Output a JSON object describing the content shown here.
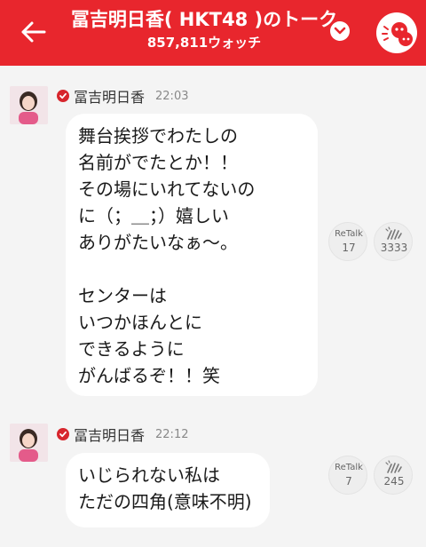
{
  "header": {
    "title": "冨吉明日香( HKT48 )のトーク",
    "watch_count": "857,811ウォッチ"
  },
  "messages": [
    {
      "sender": "冨吉明日香",
      "time": "22:03",
      "text": "舞台挨拶でわたしの\n名前がでたとか！！\nその場にいれてないの\nに（；＿；）嬉しい\nありがたいなぁ〜。\n\nセンターは\nいつかほんとに\nできるように\nがんばるぞ！！笑",
      "retalk_label": "ReTalk",
      "retalk_count": "17",
      "clap_count": "3333"
    },
    {
      "sender": "冨吉明日香",
      "time": "22:12",
      "text": "いじられない私は\nただの四角(意味不明)",
      "retalk_label": "ReTalk",
      "retalk_count": "7",
      "clap_count": "245"
    }
  ],
  "colors": {
    "header_bg": "#e8262d",
    "verified": "#d7262d",
    "background": "#f4f4f4"
  },
  "icons": [
    "back-arrow-icon",
    "chevron-down-icon",
    "mascot-icon",
    "verified-check-icon",
    "clap-icon"
  ]
}
